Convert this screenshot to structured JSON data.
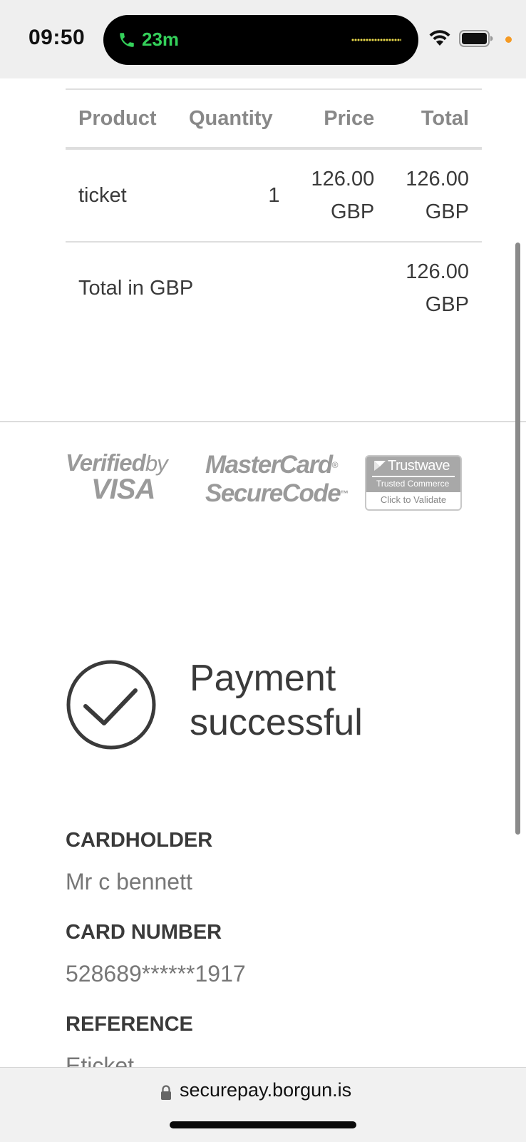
{
  "status_bar": {
    "time": "09:50",
    "call_duration": "23m",
    "accent_call": "#34d05a",
    "privacy_dot": "#f59a23"
  },
  "order_table": {
    "headers": [
      "Product",
      "Quantity",
      "Price",
      "Total"
    ],
    "rows": [
      {
        "product": "ticket",
        "quantity": "1",
        "price_amount": "126.00",
        "price_currency": "GBP",
        "total_amount": "126.00",
        "total_currency": "GBP"
      }
    ],
    "grand_total_label": "Total in GBP",
    "grand_total_amount": "126.00",
    "grand_total_currency": "GBP"
  },
  "badges": {
    "visa_line1": "Verified",
    "visa_by": "by",
    "visa_line2": "VISA",
    "mastercard_line1": "MasterCard",
    "mastercard_line2": "SecureCode",
    "trustwave_name": "Trustwave",
    "trustwave_sub": "Trusted Commerce",
    "trustwave_action": "Click to Validate"
  },
  "result": {
    "line1": "Payment",
    "line2": "successful",
    "icon": "checkmark-circle-icon"
  },
  "details": {
    "cardholder_label": "CARDHOLDER",
    "cardholder_value": "Mr c bennett",
    "card_number_label": "CARD NUMBER",
    "card_number_value": "528689******1917",
    "reference_label": "REFERENCE",
    "reference_value": "Eticket"
  },
  "browser": {
    "url": "securepay.borgun.is",
    "lock_icon": "lock-icon"
  }
}
